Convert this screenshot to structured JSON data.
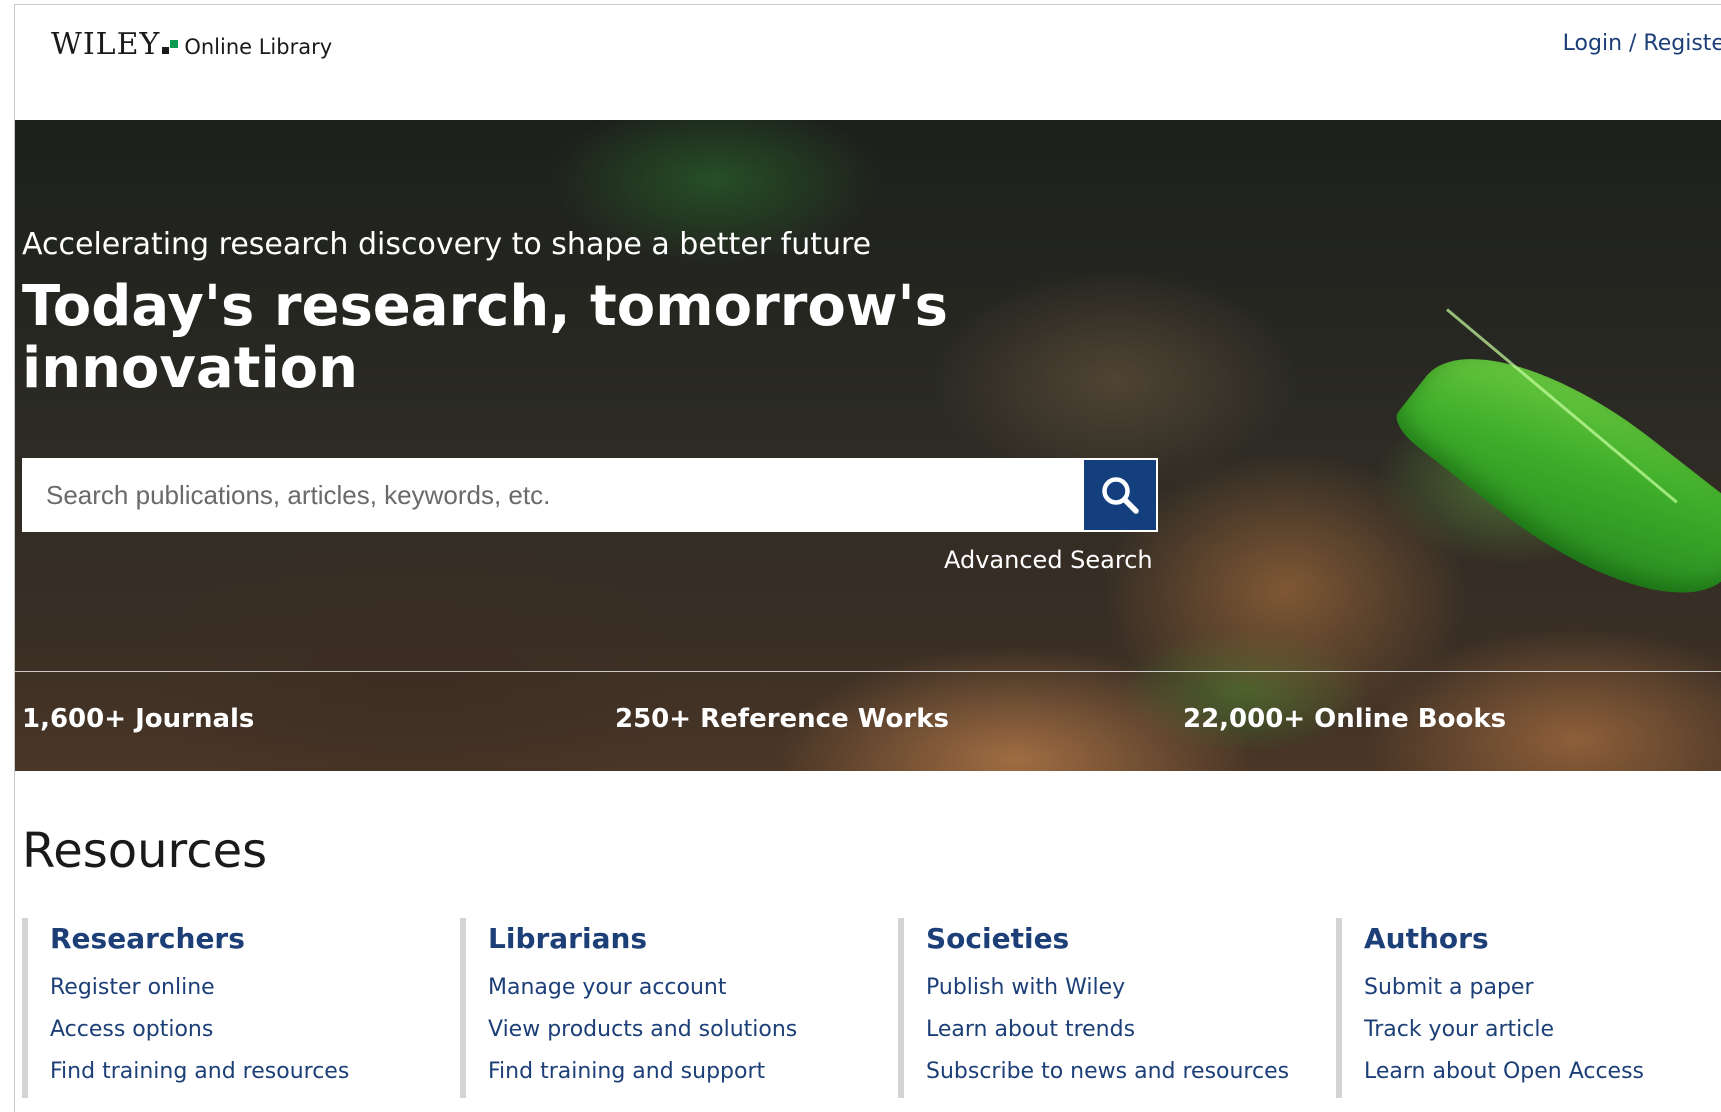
{
  "header": {
    "logo_wordmark": "WILEY",
    "logo_sub": "Online Library",
    "login_label": "Login / Register"
  },
  "hero": {
    "tagline": "Accelerating research discovery to shape a better future",
    "title": "Today's research, tomorrow's innovation",
    "search_placeholder": "Search publications, articles, keywords, etc.",
    "advanced_search_label": "Advanced Search",
    "stats": [
      {
        "label": "1,600+ Journals"
      },
      {
        "label": "250+ Reference Works"
      },
      {
        "label": "22,000+ Online Books"
      }
    ]
  },
  "resources": {
    "title": "Resources",
    "columns": [
      {
        "heading": "Researchers",
        "links": [
          "Register online",
          "Access options",
          "Find training and resources"
        ]
      },
      {
        "heading": "Librarians",
        "links": [
          "Manage your account",
          "View products and solutions",
          "Find training and support"
        ]
      },
      {
        "heading": "Societies",
        "links": [
          "Publish with Wiley",
          "Learn about trends",
          "Subscribe to news and resources"
        ]
      },
      {
        "heading": "Authors",
        "links": [
          "Submit a paper",
          "Track your article",
          "Learn about Open Access"
        ]
      }
    ]
  },
  "colors": {
    "brand_green": "#0a9a50",
    "link_blue": "#1c3f77",
    "search_button": "#133f7e"
  },
  "icons": {
    "search_button_icon": "search-icon",
    "logo_mark": "logo-squares-icon"
  }
}
